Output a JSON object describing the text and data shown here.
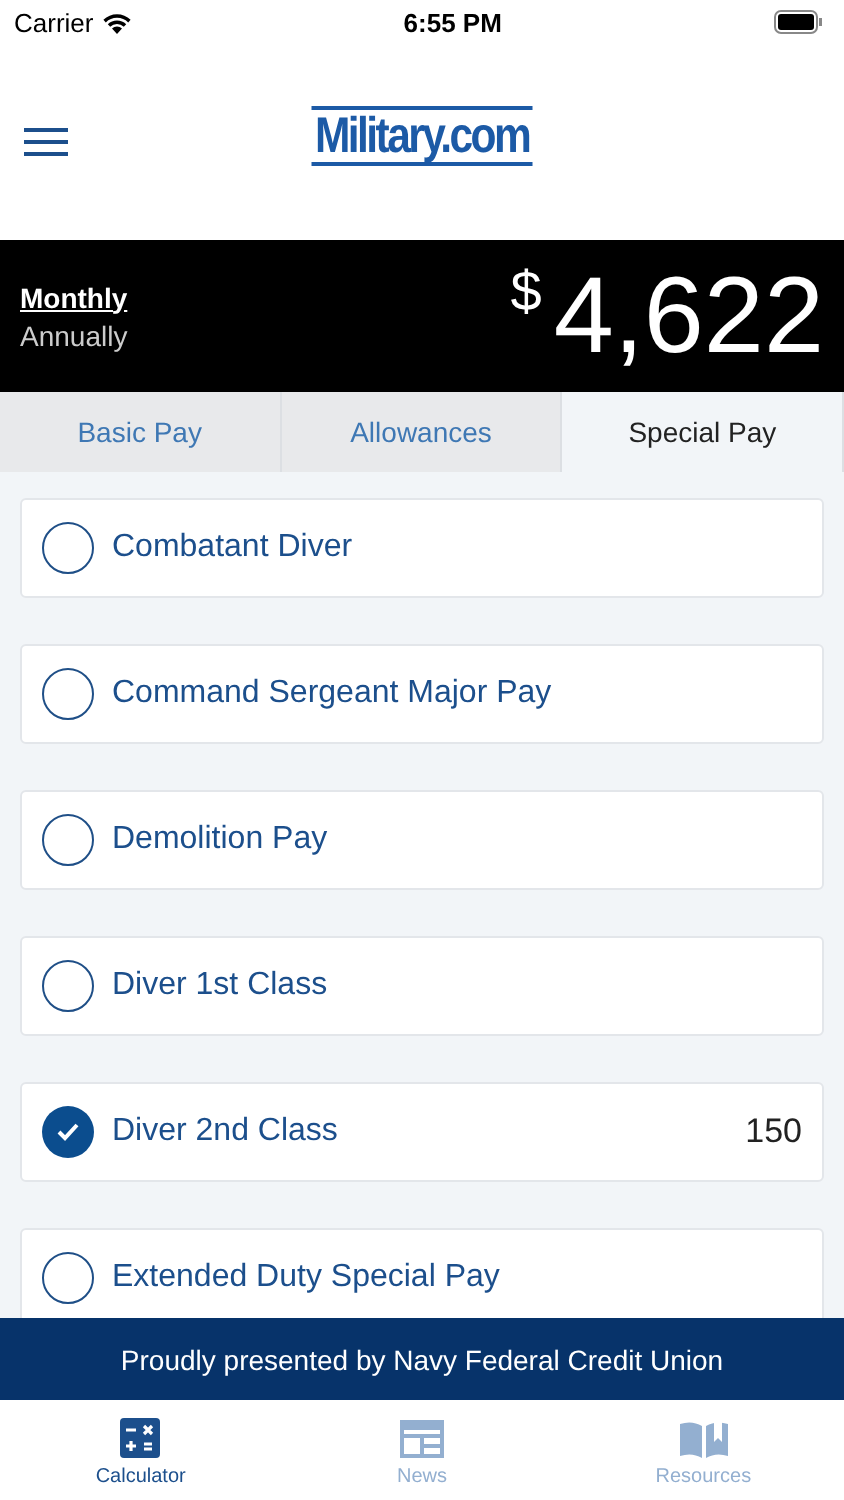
{
  "status_bar": {
    "carrier": "Carrier",
    "time": "6:55 PM"
  },
  "header": {
    "logo": "Military.com"
  },
  "summary": {
    "periods": [
      {
        "label": "Monthly",
        "selected": true
      },
      {
        "label": "Annually",
        "selected": false
      }
    ],
    "currency": "$",
    "amount": "4,622"
  },
  "tabs": [
    {
      "label": "Basic Pay",
      "selected": false
    },
    {
      "label": "Allowances",
      "selected": false
    },
    {
      "label": "Special Pay",
      "selected": true
    }
  ],
  "pays": [
    {
      "name": "Combatant Diver",
      "checked": false
    },
    {
      "name": "Command Sergeant Major Pay",
      "checked": false
    },
    {
      "name": "Demolition Pay",
      "checked": false
    },
    {
      "name": "Diver 1st Class",
      "checked": false
    },
    {
      "name": "Diver 2nd Class",
      "checked": true,
      "amount": "150"
    },
    {
      "name": "Extended Duty Special Pay",
      "checked": false
    }
  ],
  "banner": "Proudly presented by Navy Federal Credit Union",
  "tab_bar": [
    {
      "label": "Calculator",
      "kind": "calculator",
      "selected": true
    },
    {
      "label": "News",
      "kind": "news",
      "selected": false
    },
    {
      "label": "Resources",
      "kind": "book",
      "selected": false
    }
  ]
}
